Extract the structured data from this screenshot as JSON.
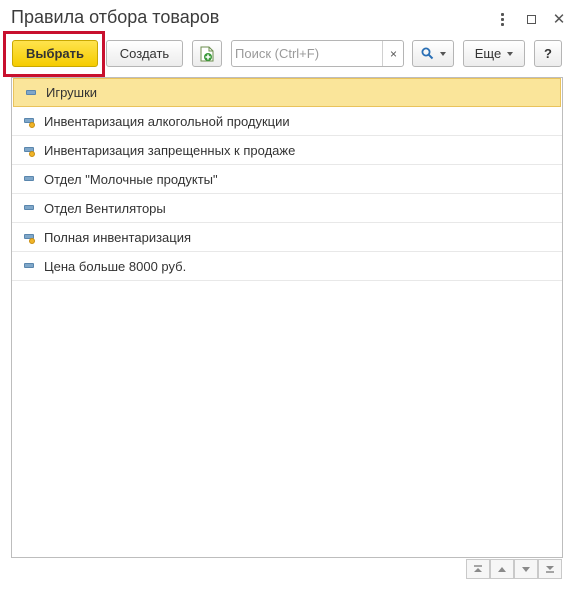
{
  "window": {
    "title": "Правила отбора товаров"
  },
  "toolbar": {
    "select_label": "Выбрать",
    "create_label": "Создать",
    "more_label": "Еще",
    "help_label": "?",
    "search_placeholder": "Поиск (Ctrl+F)",
    "search_value": "",
    "clear_label": "×"
  },
  "list": {
    "items": [
      {
        "label": "Игрушки",
        "icon": "rule-icon",
        "selected": true
      },
      {
        "label": "Инвентаризация алкогольной продукции",
        "icon": "rule-marked-icon",
        "selected": false
      },
      {
        "label": "Инвентаризация запрещенных к продаже",
        "icon": "rule-marked-icon",
        "selected": false
      },
      {
        "label": "Отдел \"Молочные продукты\"",
        "icon": "rule-icon",
        "selected": false
      },
      {
        "label": "Отдел Вентиляторы",
        "icon": "rule-icon",
        "selected": false
      },
      {
        "label": "Полная инвентаризация",
        "icon": "rule-marked-icon",
        "selected": false
      },
      {
        "label": "Цена больше 8000 руб.",
        "icon": "rule-icon",
        "selected": false
      }
    ]
  },
  "colors": {
    "accent_yellow": "#f5cc00",
    "selection_bg": "#fae59a",
    "highlight_frame": "#c8102e"
  }
}
